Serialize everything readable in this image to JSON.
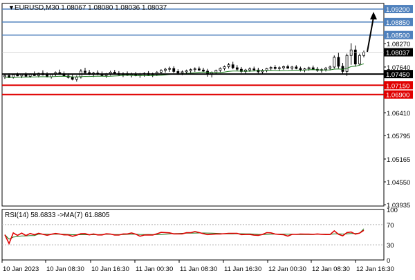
{
  "header": {
    "symbol_line": "EURUSD,M30  1.08067 1.08080 1.08036 1.08037"
  },
  "indicator": {
    "label": "RSI(14) 58.6833  ->MA(7) 61.8805"
  },
  "colors": {
    "blue_level": "#4f81bd",
    "black_level": "#000000",
    "red_level": "#e00000",
    "price_tag_bg": "#000000",
    "candle": "#000000",
    "ma_line": "#1a7a1a",
    "rsi_line": "#e00000",
    "rsi_ma_line": "#1a7a1a",
    "arrow": "#000000"
  },
  "chart_data": {
    "type": "candlestick",
    "symbol": "EURUSD",
    "timeframe": "M30",
    "last_ohlc": {
      "open": 1.08067,
      "high": 1.0808,
      "low": 1.08036,
      "close": 1.08037
    },
    "price_axis_ticks": [
      "1.08270",
      "1.07640",
      "1.06410",
      "1.05795",
      "1.05165",
      "1.04550",
      "1.03935"
    ],
    "price_axis_ticks_values": [
      1.0827,
      1.0764,
      1.0641,
      1.05795,
      1.05165,
      1.0455,
      1.03935
    ],
    "ylim": [
      1.039,
      1.0935
    ],
    "time_axis_labels": [
      "10 Jan 2023",
      "10 Jan 08:30",
      "10 Jan 16:30",
      "11 Jan 00:30",
      "11 Jan 08:30",
      "11 Jan 16:30",
      "12 Jan 00:30",
      "12 Jan 08:30",
      "12 Jan 16:30"
    ],
    "levels": [
      {
        "value": 1.092,
        "label": "1.09200",
        "kind": "resistance"
      },
      {
        "value": 1.0885,
        "label": "1.08850",
        "kind": "resistance"
      },
      {
        "value": 1.085,
        "label": "1.08500",
        "kind": "resistance"
      },
      {
        "value": 1.0745,
        "label": "1.07450",
        "kind": "pivot"
      },
      {
        "value": 1.0715,
        "label": "1.07150",
        "kind": "support"
      },
      {
        "value": 1.069,
        "label": "1.06900",
        "kind": "support"
      }
    ],
    "current_price": {
      "value": 1.08037,
      "label": "1.08037"
    },
    "arrow": {
      "from": 1.0805,
      "to": 1.092,
      "direction": "up"
    },
    "candles": [
      [
        1.0738,
        1.0745,
        1.0732,
        1.0741
      ],
      [
        1.0741,
        1.0747,
        1.0735,
        1.0737
      ],
      [
        1.0737,
        1.0745,
        1.0733,
        1.0743
      ],
      [
        1.0743,
        1.0749,
        1.0739,
        1.074
      ],
      [
        1.074,
        1.0746,
        1.0734,
        1.0744
      ],
      [
        1.0744,
        1.075,
        1.0738,
        1.0739
      ],
      [
        1.0739,
        1.0747,
        1.0735,
        1.0745
      ],
      [
        1.0745,
        1.0752,
        1.074,
        1.0741
      ],
      [
        1.0741,
        1.0749,
        1.0736,
        1.0747
      ],
      [
        1.0747,
        1.0755,
        1.0741,
        1.0743
      ],
      [
        1.0743,
        1.075,
        1.0736,
        1.0738
      ],
      [
        1.0738,
        1.0746,
        1.0733,
        1.0744
      ],
      [
        1.0744,
        1.0752,
        1.0739,
        1.0749
      ],
      [
        1.0749,
        1.0757,
        1.0744,
        1.0746
      ],
      [
        1.0746,
        1.0752,
        1.0738,
        1.074
      ],
      [
        1.074,
        1.0747,
        1.0733,
        1.0736
      ],
      [
        1.0736,
        1.0743,
        1.0728,
        1.0731
      ],
      [
        1.0731,
        1.0741,
        1.0725,
        1.0737
      ],
      [
        1.0737,
        1.0758,
        1.0733,
        1.0753
      ],
      [
        1.0753,
        1.0762,
        1.0746,
        1.0749
      ],
      [
        1.0749,
        1.0756,
        1.0742,
        1.0744
      ],
      [
        1.0744,
        1.0751,
        1.0737,
        1.0748
      ],
      [
        1.0748,
        1.0755,
        1.0742,
        1.0745
      ],
      [
        1.0745,
        1.0752,
        1.0739,
        1.0741
      ],
      [
        1.0741,
        1.0748,
        1.0735,
        1.0746
      ],
      [
        1.0746,
        1.0754,
        1.0741,
        1.075
      ],
      [
        1.075,
        1.0756,
        1.0744,
        1.0747
      ],
      [
        1.0747,
        1.0753,
        1.0741,
        1.0743
      ],
      [
        1.0743,
        1.075,
        1.0737,
        1.0746
      ],
      [
        1.0746,
        1.0752,
        1.074,
        1.0742
      ],
      [
        1.0742,
        1.0749,
        1.0736,
        1.0745
      ],
      [
        1.0745,
        1.0751,
        1.0739,
        1.0741
      ],
      [
        1.0741,
        1.0748,
        1.0735,
        1.0744
      ],
      [
        1.0744,
        1.075,
        1.0738,
        1.0747
      ],
      [
        1.0747,
        1.0753,
        1.0741,
        1.0743
      ],
      [
        1.0743,
        1.0749,
        1.0737,
        1.0746
      ],
      [
        1.0746,
        1.0753,
        1.074,
        1.075
      ],
      [
        1.075,
        1.0758,
        1.0745,
        1.0755
      ],
      [
        1.0755,
        1.0762,
        1.0749,
        1.0758
      ],
      [
        1.0758,
        1.0765,
        1.0751,
        1.076
      ],
      [
        1.076,
        1.0766,
        1.0748,
        1.0752
      ],
      [
        1.0752,
        1.0758,
        1.0743,
        1.0748
      ],
      [
        1.0748,
        1.0755,
        1.0742,
        1.0751
      ],
      [
        1.0751,
        1.0757,
        1.0745,
        1.0754
      ],
      [
        1.0754,
        1.076,
        1.0748,
        1.0757
      ],
      [
        1.0757,
        1.0763,
        1.0751,
        1.0759
      ],
      [
        1.0759,
        1.0765,
        1.0753,
        1.0756
      ],
      [
        1.0756,
        1.0762,
        1.075,
        1.0753
      ],
      [
        1.0753,
        1.0759,
        1.0738,
        1.0744
      ],
      [
        1.0744,
        1.0752,
        1.0736,
        1.0749
      ],
      [
        1.0749,
        1.0757,
        1.0744,
        1.0755
      ],
      [
        1.0755,
        1.0763,
        1.075,
        1.076
      ],
      [
        1.076,
        1.0768,
        1.0755,
        1.0765
      ],
      [
        1.0765,
        1.0775,
        1.076,
        1.077
      ],
      [
        1.077,
        1.0778,
        1.0758,
        1.0762
      ],
      [
        1.0762,
        1.0769,
        1.0754,
        1.0758
      ],
      [
        1.0758,
        1.0764,
        1.0748,
        1.0752
      ],
      [
        1.0752,
        1.0759,
        1.0745,
        1.0756
      ],
      [
        1.0756,
        1.0763,
        1.0751,
        1.0759
      ],
      [
        1.0759,
        1.0765,
        1.0753,
        1.0756
      ],
      [
        1.0756,
        1.0762,
        1.0747,
        1.0751
      ],
      [
        1.0751,
        1.0758,
        1.0745,
        1.0755
      ],
      [
        1.0755,
        1.0762,
        1.075,
        1.076
      ],
      [
        1.076,
        1.0766,
        1.0755,
        1.0763
      ],
      [
        1.0763,
        1.0769,
        1.0757,
        1.076
      ],
      [
        1.076,
        1.0766,
        1.0754,
        1.0762
      ],
      [
        1.0762,
        1.0768,
        1.0757,
        1.0765
      ],
      [
        1.0765,
        1.077,
        1.0759,
        1.0761
      ],
      [
        1.0761,
        1.0767,
        1.0755,
        1.0764
      ],
      [
        1.0764,
        1.0769,
        1.0758,
        1.076
      ],
      [
        1.076,
        1.0765,
        1.0752,
        1.0756
      ],
      [
        1.0756,
        1.0762,
        1.075,
        1.0759
      ],
      [
        1.0759,
        1.0765,
        1.0754,
        1.0762
      ],
      [
        1.0762,
        1.0768,
        1.0756,
        1.0758
      ],
      [
        1.0758,
        1.0764,
        1.0751,
        1.0755
      ],
      [
        1.0755,
        1.0761,
        1.0749,
        1.0757
      ],
      [
        1.0757,
        1.0764,
        1.0752,
        1.0761
      ],
      [
        1.0761,
        1.0768,
        1.0755,
        1.0764
      ],
      [
        1.0764,
        1.0795,
        1.076,
        1.079
      ],
      [
        1.079,
        1.0802,
        1.076,
        1.0766
      ],
      [
        1.0766,
        1.0775,
        1.0745,
        1.0752
      ],
      [
        1.0752,
        1.08,
        1.074,
        1.0795
      ],
      [
        1.0795,
        1.0828,
        1.077,
        1.081
      ],
      [
        1.081,
        1.0822,
        1.0765,
        1.0772
      ],
      [
        1.0772,
        1.08,
        1.0768,
        1.0795
      ],
      [
        1.0795,
        1.0808,
        1.079,
        1.0804
      ]
    ],
    "rsi": {
      "label": "RSI(14)",
      "value": 58.6833,
      "ma_label": "MA(7)",
      "ma_value": 61.8805,
      "levels": [
        70,
        30
      ],
      "scale_labels": [
        "100",
        "70",
        "30",
        "0"
      ],
      "ylim": [
        0,
        100
      ]
    }
  }
}
